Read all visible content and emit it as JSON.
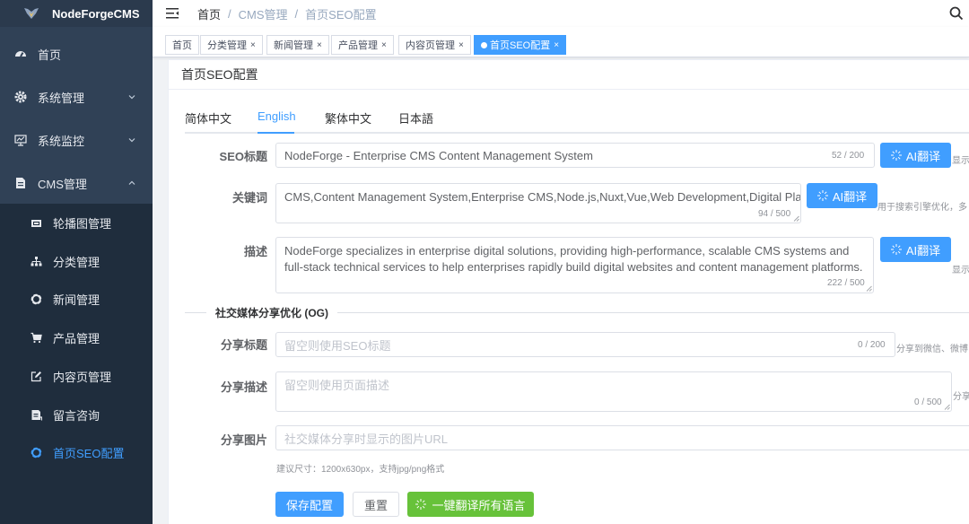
{
  "sidebar": {
    "app_name": "NodeForgeCMS",
    "menu": [
      {
        "label": "首页",
        "icon": "dashboard-icon"
      },
      {
        "label": "系统管理",
        "icon": "gear-icon"
      },
      {
        "label": "系统监控",
        "icon": "monitor-icon"
      },
      {
        "label": "CMS管理",
        "icon": "document-icon"
      }
    ],
    "cms_sub": [
      {
        "label": "轮播图管理",
        "icon": "carousel-icon"
      },
      {
        "label": "分类管理",
        "icon": "tree-icon"
      },
      {
        "label": "新闻管理",
        "icon": "ring-icon"
      },
      {
        "label": "产品管理",
        "icon": "cart-icon"
      },
      {
        "label": "内容页管理",
        "icon": "edit-icon"
      },
      {
        "label": "留言咨询",
        "icon": "message-icon"
      },
      {
        "label": "首页SEO配置",
        "icon": "ring-icon",
        "active": true
      }
    ]
  },
  "header": {
    "breadcrumb": [
      "首页",
      "CMS管理",
      "首页SEO配置"
    ],
    "separator": "/"
  },
  "tags": [
    {
      "label": "首页",
      "closable": false
    },
    {
      "label": "分类管理",
      "closable": true
    },
    {
      "label": "新闻管理",
      "closable": true
    },
    {
      "label": "产品管理",
      "closable": true
    },
    {
      "label": "内容页管理",
      "closable": true
    },
    {
      "label": "首页SEO配置",
      "closable": true,
      "active": true
    }
  ],
  "close_glyph": "×",
  "card": {
    "title": "首页SEO配置",
    "tabs": [
      "简体中文",
      "English",
      "繁体中文",
      "日本語"
    ],
    "active_tab": "English"
  },
  "form": {
    "seo_title": {
      "label": "SEO标题",
      "value": "NodeForge - Enterprise CMS Content Management System",
      "count": "52 / 200",
      "hint": "显示"
    },
    "keywords": {
      "label": "关键词",
      "value": "CMS,Content Management System,Enterprise CMS,Node.js,Nuxt,Vue,Web Development,Digital Platform",
      "count": "94 / 500",
      "hint": "用于搜索引擎优化，多"
    },
    "description": {
      "label": "描述",
      "value": "NodeForge specializes in enterprise digital solutions, providing high-performance, scalable CMS systems and full-stack technical services to help enterprises rapidly build digital websites and content management platforms.",
      "count": "222 / 500",
      "hint": "显示"
    },
    "ai_translate_label": "AI翻译",
    "og_section_title": "社交媒体分享优化 (OG)",
    "og_title": {
      "label": "分享标题",
      "placeholder": "留空则使用SEO标题",
      "count": "0 / 200",
      "hint": "分享到微信、微博"
    },
    "og_description": {
      "label": "分享描述",
      "placeholder": "留空则使用页面描述",
      "count": "0 / 500",
      "hint": "分享"
    },
    "og_image": {
      "label": "分享图片",
      "placeholder": "社交媒体分享时显示的图片URL",
      "tip": "建议尺寸：1200x630px，支持jpg/png格式"
    }
  },
  "actions": {
    "save": "保存配置",
    "reset": "重置",
    "translate_all": "一键翻译所有语言"
  },
  "colors": {
    "primary": "#409eff",
    "success": "#67c23a",
    "sidebar_bg": "#304156",
    "submenu_bg": "#1f2d3d"
  }
}
